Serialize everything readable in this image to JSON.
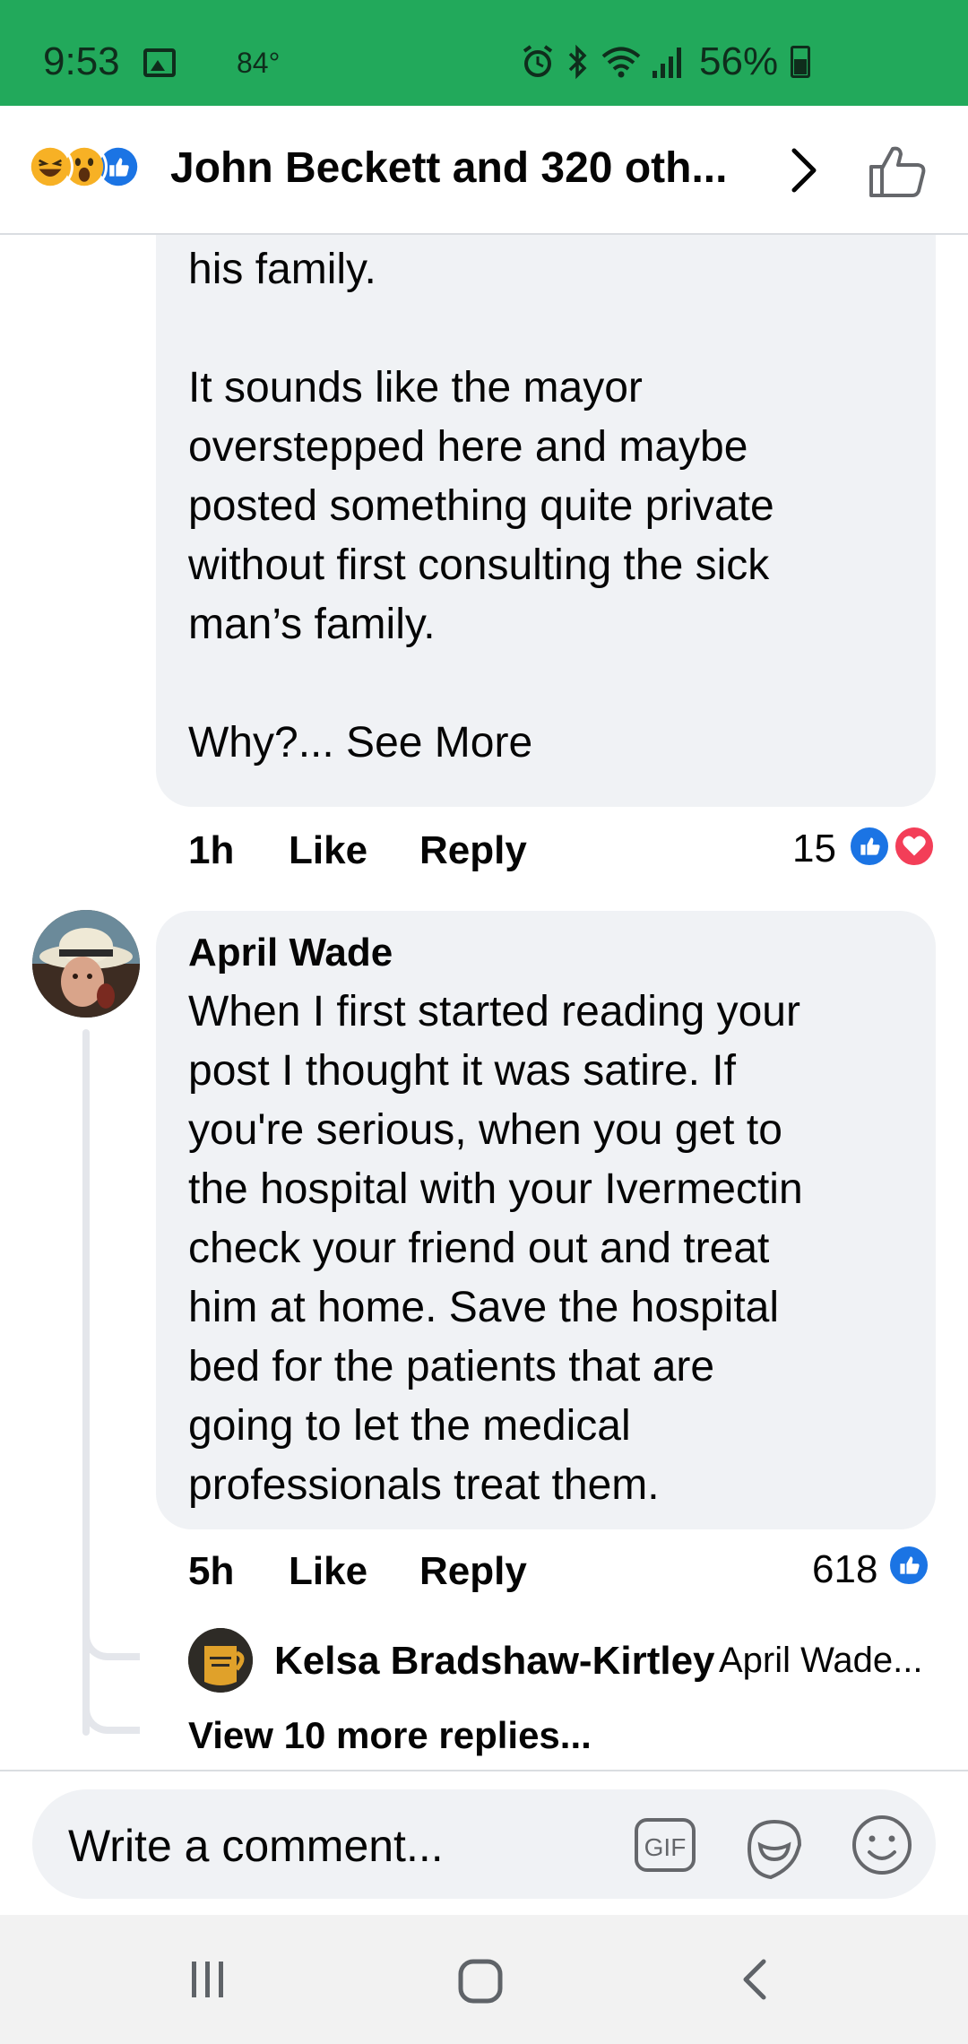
{
  "status_bar": {
    "time": "9:53",
    "temperature": "84°",
    "battery": "56%"
  },
  "header": {
    "title": "John Beckett and 320 oth...",
    "reaction_icons": [
      "laugh-reaction-icon",
      "wow-reaction-icon",
      "like-reaction-icon"
    ]
  },
  "comments": [
    {
      "text_lines": "because it’s causing problems in\nhis family.\n\nIt sounds like the mayor\noverstepped here and maybe\nposted something quite private\nwithout first consulting the sick\nman’s family.\n\nWhy?...",
      "see_more": "See More",
      "time": "1h",
      "like_label": "Like",
      "reply_label": "Reply",
      "reaction_count": "15",
      "reactions": [
        "like-reaction-icon",
        "love-reaction-icon"
      ]
    },
    {
      "author": "April Wade",
      "text": "When I first started reading your\npost I thought it was satire. If\nyou're serious, when you get to\nthe hospital with your Ivermectin\ncheck your friend out and treat\nhim at home. Save the hospital\nbed for the patients that are\ngoing to let the medical\nprofessionals treat them.",
      "time": "5h",
      "like_label": "Like",
      "reply_label": "Reply",
      "reaction_count": "618",
      "reactions": [
        "like-reaction-icon"
      ],
      "reply_preview": {
        "author": "Kelsa Bradshaw-Kirtley",
        "snippet": "April Wade..."
      },
      "view_more": "View 10 more replies..."
    }
  ],
  "composer": {
    "placeholder": "Write a comment...",
    "gif_label": "GIF"
  },
  "colors": {
    "status_bar_bg": "#22a95b",
    "bubble_bg": "#f0f2f5",
    "like_blue": "#1b74e4",
    "love_red": "#f33e58"
  }
}
